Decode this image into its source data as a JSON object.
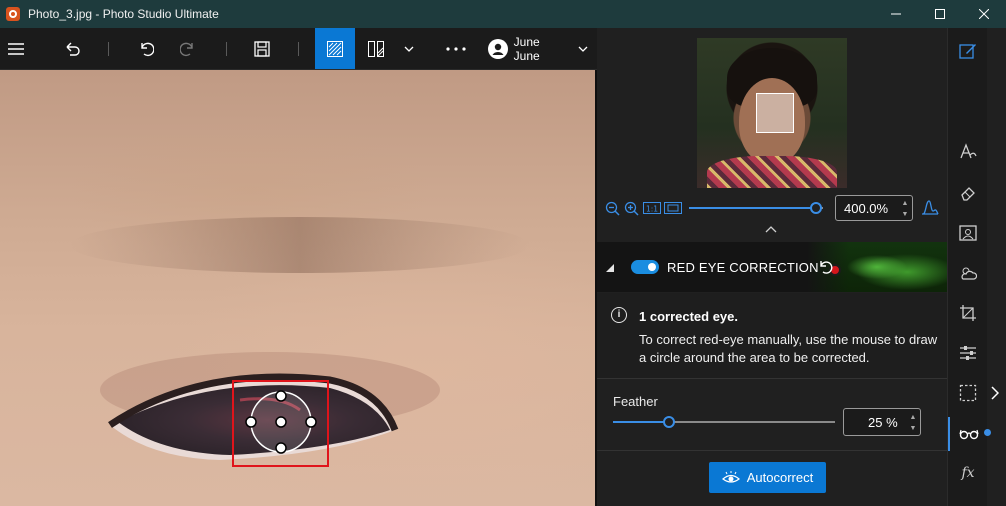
{
  "window": {
    "title": "Photo_3.jpg - Photo Studio Ultimate"
  },
  "toolbar": {
    "user_name": "June June",
    "items": [
      "menu-icon",
      "undo-history-icon",
      "undo-icon",
      "redo-icon",
      "save-icon",
      "compare-icon",
      "split-view-icon",
      "more-icon"
    ]
  },
  "navigator": {
    "zoom_value": "400.0%",
    "zoom_level": 0.95,
    "fit_label": "1:1"
  },
  "red_eye": {
    "title": "RED EYE CORRECTION",
    "enabled": true,
    "info_title": "1 corrected eye.",
    "info_body": "To correct red-eye manually, use the mouse to draw a circle around the area to be corrected.",
    "feather_label": "Feather",
    "feather_value": "25 %",
    "feather_level": 0.25,
    "autocorrect_label": "Autocorrect"
  },
  "rail": {
    "items": [
      "edit-icon",
      "text-icon",
      "eraser-icon",
      "portrait-icon",
      "weather-icon",
      "crop-icon",
      "adjust-icon",
      "selection-icon",
      "red-eye-icon",
      "effects-icon"
    ],
    "effects_label": "fx"
  },
  "colors": {
    "accent": "#0a78d4",
    "titlebar": "#1e3b3d",
    "selection_box": "#e0141b"
  }
}
